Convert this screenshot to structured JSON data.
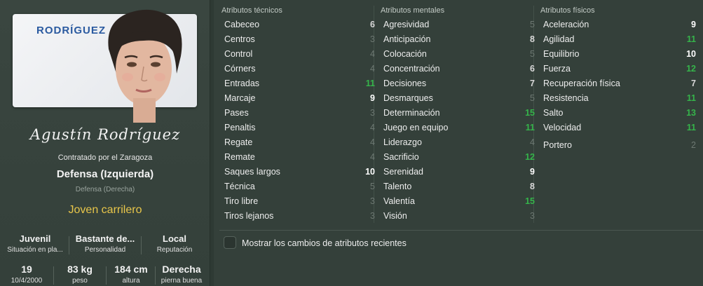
{
  "player": {
    "card_name": "RODRÍGUEZ",
    "signature": "Agustín Rodríguez",
    "contract": "Contratado por el Zaragoza",
    "position": "Defensa (Izquierda)",
    "position_alt": "Defensa (Derecha)",
    "role": "Joven carrilero",
    "info_top": [
      {
        "value": "Juvenil",
        "label": "Situación en pla..."
      },
      {
        "value": "Bastante de...",
        "label": "Personalidad"
      },
      {
        "value": "Local",
        "label": "Reputación"
      }
    ],
    "info_bottom": [
      {
        "value": "19",
        "label": "10/4/2000"
      },
      {
        "value": "83 kg",
        "label": "peso"
      },
      {
        "value": "184 cm",
        "label": "altura"
      },
      {
        "value": "Derecha",
        "label": "pierna buena"
      }
    ]
  },
  "attributes": {
    "technical": {
      "title": "Atributos técnicos",
      "items": [
        {
          "name": "Cabeceo",
          "value": "6"
        },
        {
          "name": "Centros",
          "value": "3"
        },
        {
          "name": "Control",
          "value": "4"
        },
        {
          "name": "Córners",
          "value": "4"
        },
        {
          "name": "Entradas",
          "value": "11"
        },
        {
          "name": "Marcaje",
          "value": "9"
        },
        {
          "name": "Pases",
          "value": "3"
        },
        {
          "name": "Penaltis",
          "value": "4"
        },
        {
          "name": "Regate",
          "value": "4"
        },
        {
          "name": "Remate",
          "value": "4"
        },
        {
          "name": "Saques largos",
          "value": "10"
        },
        {
          "name": "Técnica",
          "value": "5"
        },
        {
          "name": "Tiro libre",
          "value": "3"
        },
        {
          "name": "Tiros lejanos",
          "value": "3"
        }
      ]
    },
    "mental": {
      "title": "Atributos mentales",
      "items": [
        {
          "name": "Agresividad",
          "value": "5"
        },
        {
          "name": "Anticipación",
          "value": "8"
        },
        {
          "name": "Colocación",
          "value": "5"
        },
        {
          "name": "Concentración",
          "value": "6"
        },
        {
          "name": "Decisiones",
          "value": "7"
        },
        {
          "name": "Desmarques",
          "value": "5"
        },
        {
          "name": "Determinación",
          "value": "15"
        },
        {
          "name": "Juego en equipo",
          "value": "11"
        },
        {
          "name": "Liderazgo",
          "value": "4"
        },
        {
          "name": "Sacrificio",
          "value": "12"
        },
        {
          "name": "Serenidad",
          "value": "9"
        },
        {
          "name": "Talento",
          "value": "8"
        },
        {
          "name": "Valentía",
          "value": "15"
        },
        {
          "name": "Visión",
          "value": "3"
        }
      ]
    },
    "physical": {
      "title": "Atributos físicos",
      "items": [
        {
          "name": "Aceleración",
          "value": "9"
        },
        {
          "name": "Agilidad",
          "value": "11"
        },
        {
          "name": "Equilibrio",
          "value": "10"
        },
        {
          "name": "Fuerza",
          "value": "12"
        },
        {
          "name": "Recuperación física",
          "value": "7"
        },
        {
          "name": "Resistencia",
          "value": "11"
        },
        {
          "name": "Salto",
          "value": "13"
        },
        {
          "name": "Velocidad",
          "value": "11"
        }
      ],
      "extra": {
        "name": "Portero",
        "value": "2"
      }
    }
  },
  "toggle": {
    "label": "Mostrar los cambios de atributos recientes",
    "checked": false
  },
  "colors": {
    "green": "#35b44a",
    "dim": "#6d7872",
    "role": "#e8c64a",
    "card_name": "#2a5aa0"
  }
}
